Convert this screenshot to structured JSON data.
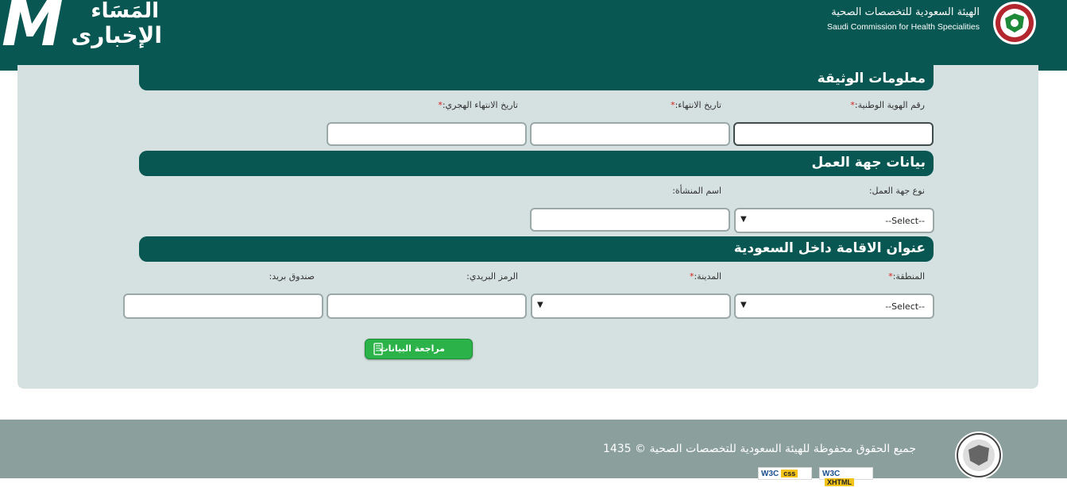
{
  "header": {
    "logo_left": {
      "mark": "M",
      "line1": "المَسَاء",
      "line2": "الإخبارى"
    },
    "brand_ar": "الهيئة السعودية للتخصصات الصحية",
    "brand_en": "Saudi Commission for Health Specialities"
  },
  "sections": {
    "document": {
      "title": "معلومات الوثيقة",
      "fields": {
        "national_id": {
          "label": "رقم الهوية الوطنية:",
          "required": "*",
          "value": ""
        },
        "expiry_date": {
          "label": "تاريخ الانتهاء:",
          "required": "*",
          "value": ""
        },
        "hijri_expiry": {
          "label": "تاريخ الانتهاء الهجري:",
          "required": "*",
          "value": ""
        }
      }
    },
    "employer": {
      "title": "بيانات جهة العمل",
      "fields": {
        "employer_type": {
          "label": "نوع جهة العمل:",
          "selected": "--Select--"
        },
        "facility_name": {
          "label": "اسم المنشأة:",
          "value": ""
        }
      }
    },
    "address": {
      "title": "عنوان الاقامة داخل السعودية",
      "fields": {
        "region": {
          "label": "المنطقة:",
          "required": "*",
          "selected": "--Select--"
        },
        "city": {
          "label": "المدينة:",
          "required": "*",
          "selected": ""
        },
        "postal_code": {
          "label": "الرمز البريدي:",
          "value": ""
        },
        "po_box": {
          "label": "صندوق بريد:",
          "value": ""
        }
      }
    }
  },
  "review_button": {
    "label": "مراجعة البيانات",
    "icon": "document-icon"
  },
  "footer": {
    "copyright": "جميع الحقوق محفوظة للهيئة السعودية للتخصصات الصحية © 1435",
    "badges": [
      {
        "name": "W3C",
        "tag": "css"
      },
      {
        "name": "W3C",
        "tag": "XHTML"
      }
    ]
  },
  "colors": {
    "primary": "#095752",
    "panel": "#d5e1e0",
    "button": "#2bb34a",
    "footer": "#8b9f9d",
    "required": "#d81e1e"
  }
}
